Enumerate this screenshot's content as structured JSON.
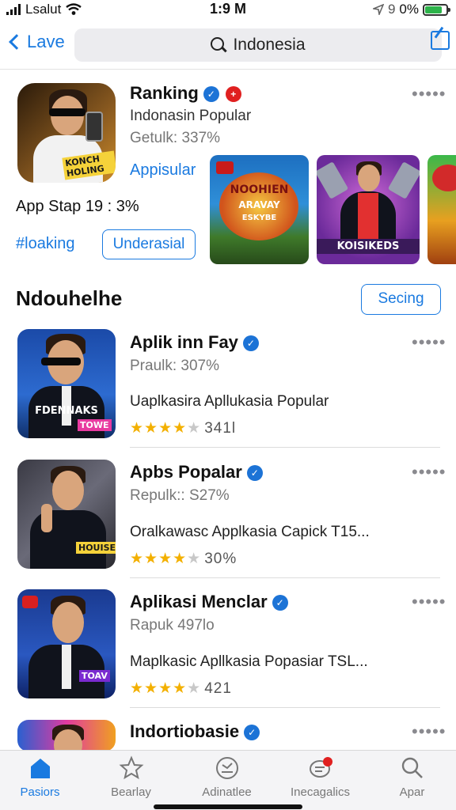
{
  "status_bar": {
    "carrier": "Lsalut",
    "time": "1:9 M",
    "battery_label": "0%",
    "battery_prefix": "9"
  },
  "nav": {
    "back_label": "Lave",
    "search_text": "Indonesia"
  },
  "featured": {
    "title": "Ranking",
    "subtitle": "Indonasin Popular",
    "meta": "Getulk: 337%",
    "link": "Appisular",
    "rank_text": "App Stap 19 : 3%",
    "hashtag": "#loaking",
    "button_label": "Underasial",
    "icon_tag": "KONCH HOLING",
    "screenshots": [
      {
        "caption_top": "NOOHIEN",
        "caption_mid": "ARAVAY",
        "caption_bot": "ESKYBE"
      },
      {
        "caption_top": "KOISIKEDS"
      }
    ]
  },
  "section": {
    "title": "Ndouhelhe",
    "action_label": "Secing"
  },
  "apps": [
    {
      "title": "Aplik inn Fay",
      "meta": "Praulk: 307%",
      "desc": "Uaplkasira Apllukasia Popular",
      "rating": 4.5,
      "count": "341l",
      "icon_caption": "FDENNAKS",
      "icon_tag": "TOWE"
    },
    {
      "title": "Apbs Popalar",
      "meta": "Repulk:: S27%",
      "desc": "Oralkawasc Applkasia Capick  T15...",
      "rating": 4.5,
      "count": "30%",
      "icon_tag": "HOUISE"
    },
    {
      "title": "Aplikasi Menclar",
      "meta": "Rapuk 497lo",
      "desc": "Maplkasic Apllkasia Popasiar  TSL...",
      "rating": 4.5,
      "count": "421",
      "icon_tag": "TOAV"
    },
    {
      "title": "Indortiobasie",
      "meta": "",
      "desc": "",
      "rating": 0,
      "count": ""
    }
  ],
  "tabs": [
    {
      "label": "Pasiors",
      "icon": "home-icon",
      "active": true
    },
    {
      "label": "Bearlay",
      "icon": "star-icon",
      "active": false
    },
    {
      "label": "Adinatlee",
      "icon": "sticker-icon",
      "active": false
    },
    {
      "label": "Inecagalics",
      "icon": "chat-icon",
      "active": false
    },
    {
      "label": "Apar",
      "icon": "search-icon",
      "active": false
    }
  ],
  "colors": {
    "accent": "#1a7ae0",
    "star": "#f3b000",
    "verified": "#1c73d6",
    "alert": "#e02020"
  }
}
